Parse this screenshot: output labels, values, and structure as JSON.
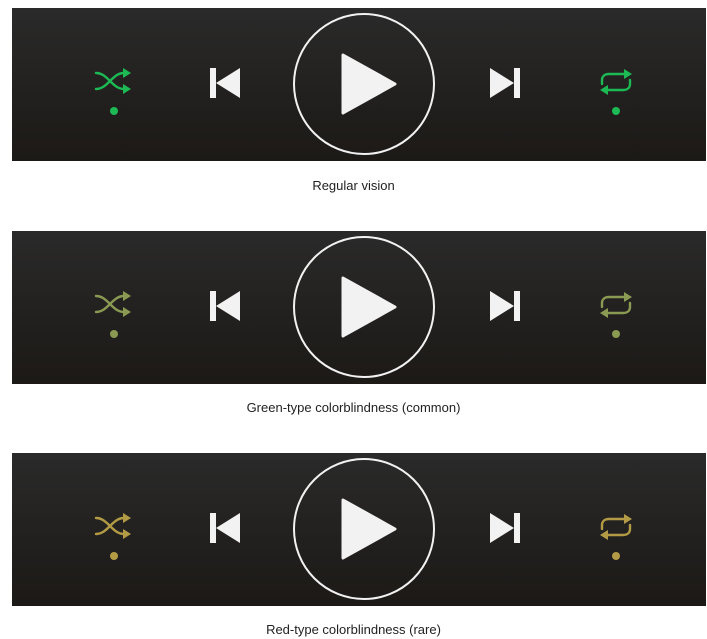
{
  "panels": [
    {
      "caption": "Regular vision",
      "accent": "#1db954"
    },
    {
      "caption": "Green-type colorblindness (common)",
      "accent": "#8a9a52"
    },
    {
      "caption": "Red-type colorblindness (rare)",
      "accent": "#b39b45"
    }
  ],
  "icons": {
    "shuffle": "shuffle-icon",
    "previous": "skip-previous-icon",
    "play": "play-icon",
    "next": "skip-next-icon",
    "repeat": "repeat-icon"
  },
  "colors": {
    "foreground": "#f2f2f2",
    "background": "#222222"
  }
}
